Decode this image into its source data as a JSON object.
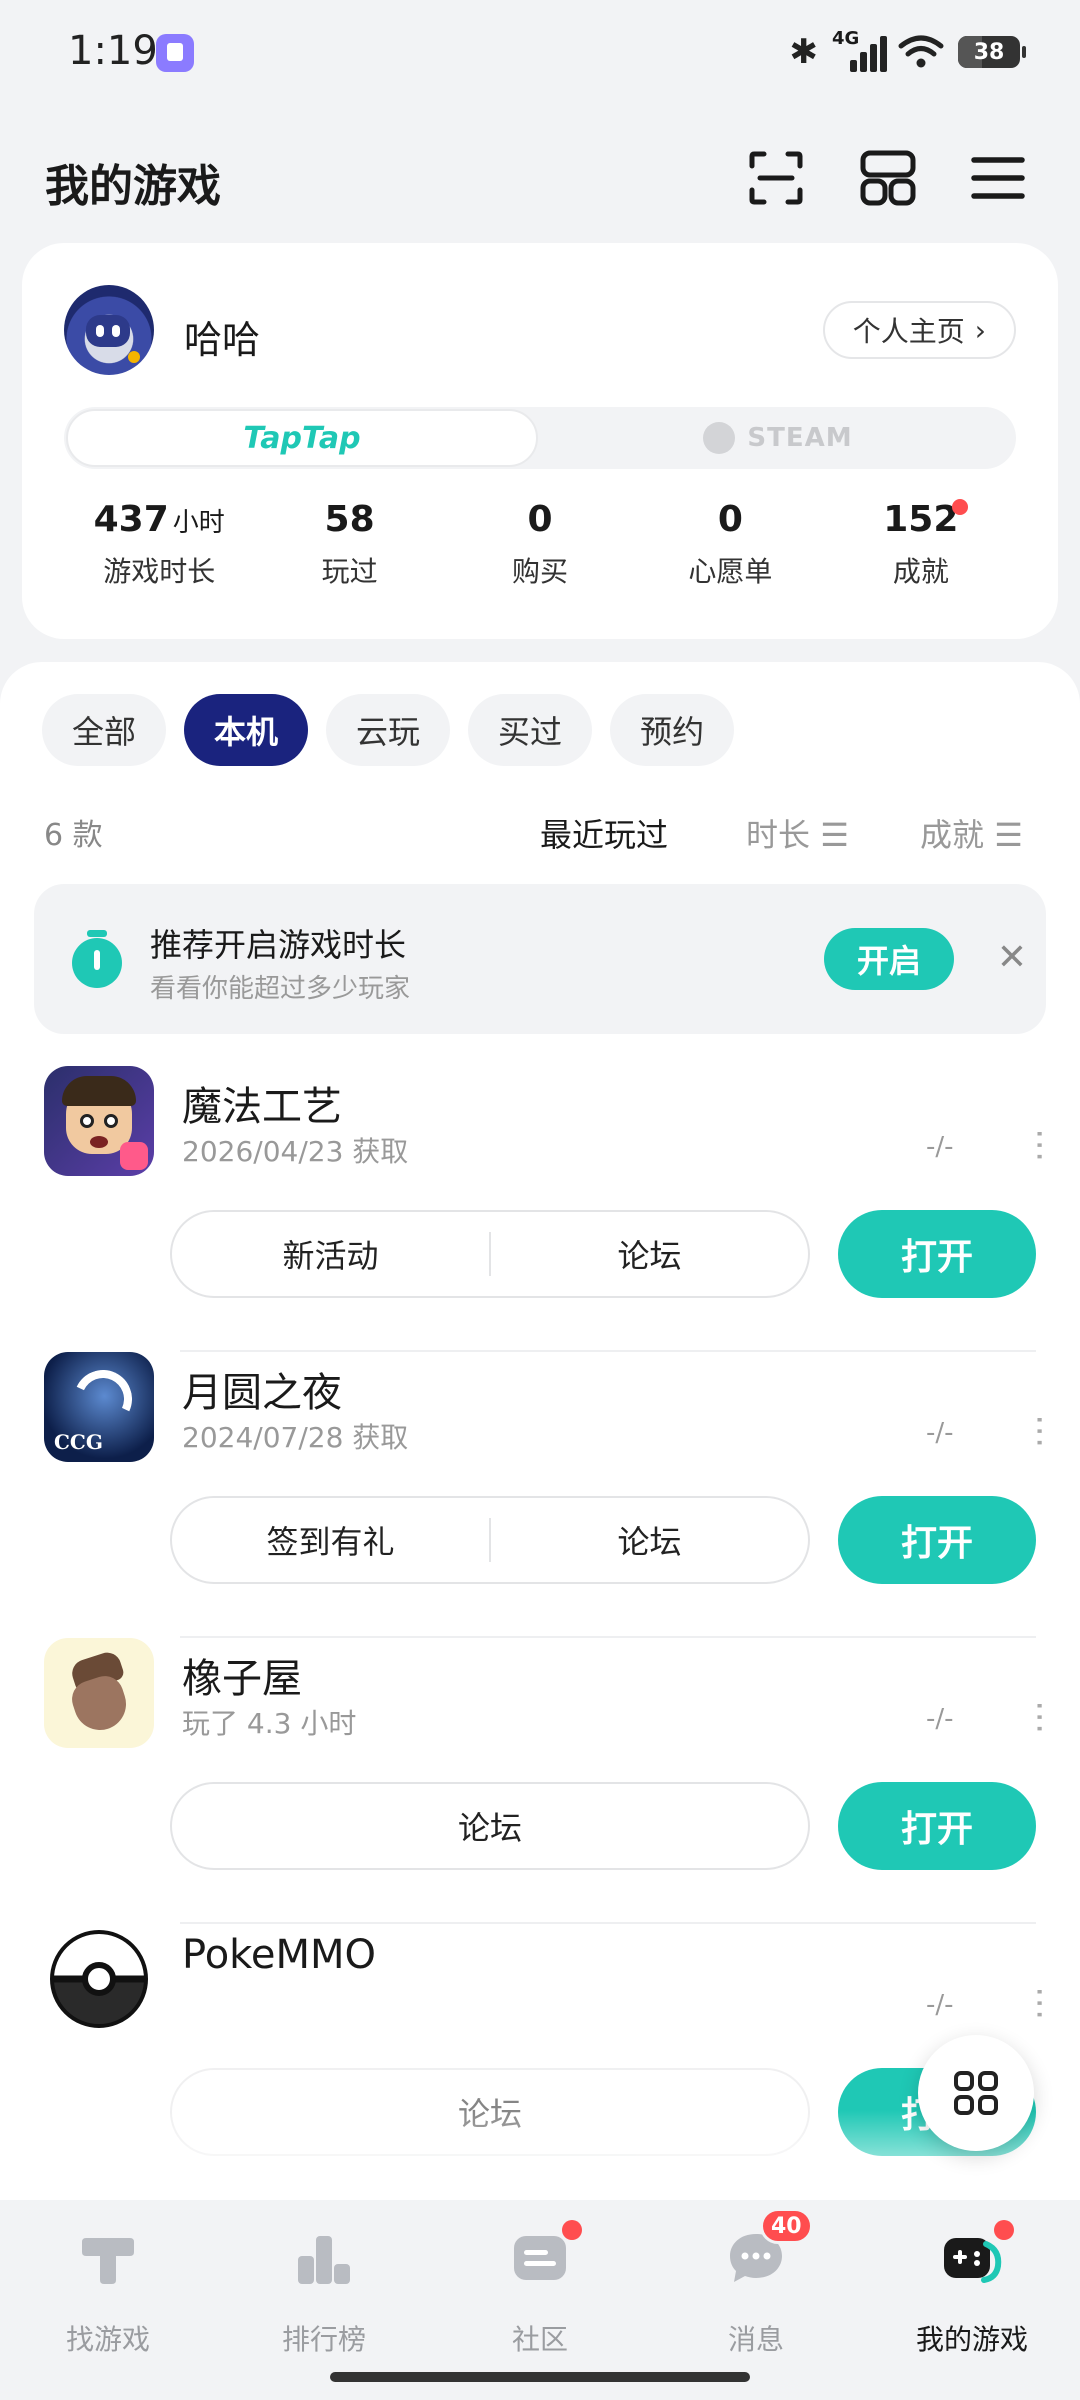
{
  "status_bar": {
    "time": "1:19",
    "network": "4G",
    "battery": "38",
    "battery_level": 0.38
  },
  "header": {
    "title": "我的游戏",
    "icons": [
      "scan-icon",
      "grid-layout-icon",
      "menu-icon"
    ]
  },
  "profile": {
    "username": "哈哈",
    "profile_link": "个人主页",
    "platforms": {
      "taptap": "TapTap",
      "steam": "STEAM",
      "active": "TapTap"
    },
    "stats": [
      {
        "value": "437",
        "unit": "小时",
        "label": "游戏时长"
      },
      {
        "value": "58",
        "unit": "",
        "label": "玩过"
      },
      {
        "value": "0",
        "unit": "",
        "label": "购买"
      },
      {
        "value": "0",
        "unit": "",
        "label": "心愿单"
      },
      {
        "value": "152",
        "unit": "",
        "label": "成就"
      }
    ]
  },
  "filters": {
    "chips": [
      {
        "label": "全部",
        "active": false
      },
      {
        "label": "本机",
        "active": true
      },
      {
        "label": "云玩",
        "active": false
      },
      {
        "label": "买过",
        "active": false
      },
      {
        "label": "预约",
        "active": false
      }
    ],
    "count": "6 款",
    "sort": {
      "recent": "最近玩过",
      "duration": "时长",
      "achievement": "成就"
    }
  },
  "banner": {
    "title": "推荐开启游戏时长",
    "subtitle": "看看你能超过多少玩家",
    "button": "开启"
  },
  "games": [
    {
      "name": "魔法工艺",
      "subtitle": "2026/04/23 获取",
      "time": "-/-",
      "actions": [
        "新活动",
        "论坛"
      ],
      "open": "打开"
    },
    {
      "name": "月圆之夜",
      "subtitle": "2024/07/28 获取",
      "time": "-/-",
      "actions": [
        "签到有礼",
        "论坛"
      ],
      "open": "打开",
      "icon_text": "CCG"
    },
    {
      "name": "橡子屋",
      "subtitle": "玩了 4.3 小时",
      "time": "-/-",
      "actions": [
        "论坛"
      ],
      "open": "打开"
    },
    {
      "name": "PokeMMO",
      "subtitle": "",
      "time": "-/-",
      "actions": [
        "论坛"
      ],
      "open": "打开"
    }
  ],
  "bottom_nav": [
    {
      "label": "找游戏",
      "icon": "find-games-icon",
      "active": false
    },
    {
      "label": "排行榜",
      "icon": "ranking-icon",
      "active": false
    },
    {
      "label": "社区",
      "icon": "community-icon",
      "active": false
    },
    {
      "label": "消息",
      "icon": "messages-icon",
      "active": false,
      "badge": "40"
    },
    {
      "label": "我的游戏",
      "icon": "my-games-icon",
      "active": true
    }
  ],
  "colors": {
    "accent": "#1fc8b5",
    "chip_active": "#1a237e",
    "badge": "#ff4d4f"
  }
}
